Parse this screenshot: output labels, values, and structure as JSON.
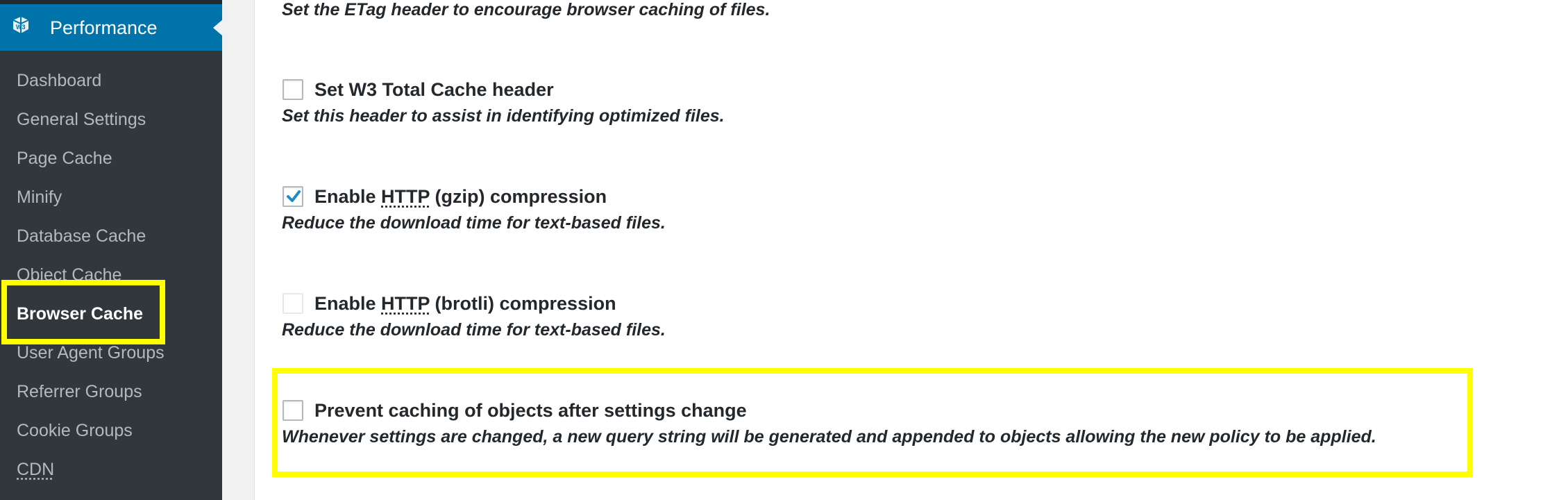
{
  "sidebar": {
    "menu_title": "Performance",
    "menu_icon": "w3tc-logo-icon",
    "items": [
      {
        "label": "Dashboard"
      },
      {
        "label": "General Settings"
      },
      {
        "label": "Page Cache"
      },
      {
        "label": "Minify"
      },
      {
        "label": "Database Cache"
      },
      {
        "label": "Object Cache"
      },
      {
        "label": "Browser Cache"
      },
      {
        "label": "User Agent Groups"
      },
      {
        "label": "Referrer Groups"
      },
      {
        "label": "Cookie Groups"
      },
      {
        "label": "CDN"
      }
    ],
    "current": "Browser Cache"
  },
  "options": {
    "etag": {
      "description": "Set the ETag header to encourage browser caching of files."
    },
    "w3tc_header": {
      "label": "Set W3 Total Cache header",
      "description": "Set this header to assist in identifying optimized files.",
      "checked": false
    },
    "gzip": {
      "label_pre": "Enable ",
      "label_abbr": "HTTP",
      "label_post": " (gzip) compression",
      "description": "Reduce the download time for text-based files.",
      "checked": true
    },
    "brotli": {
      "label_pre": "Enable ",
      "label_abbr": "HTTP",
      "label_post": " (brotli) compression",
      "description": "Reduce the download time for text-based files.",
      "checked": false,
      "disabled": true
    },
    "prevent_caching": {
      "label": "Prevent caching of objects after settings change",
      "description": "Whenever settings are changed, a new query string will be generated and appended to objects allowing the new policy to be applied.",
      "checked": false
    }
  },
  "colors": {
    "sidebar_bg": "#32373c",
    "menu_active_bg": "#0073aa",
    "highlight": "#ffff00",
    "checkmark": "#1e8cbe"
  }
}
